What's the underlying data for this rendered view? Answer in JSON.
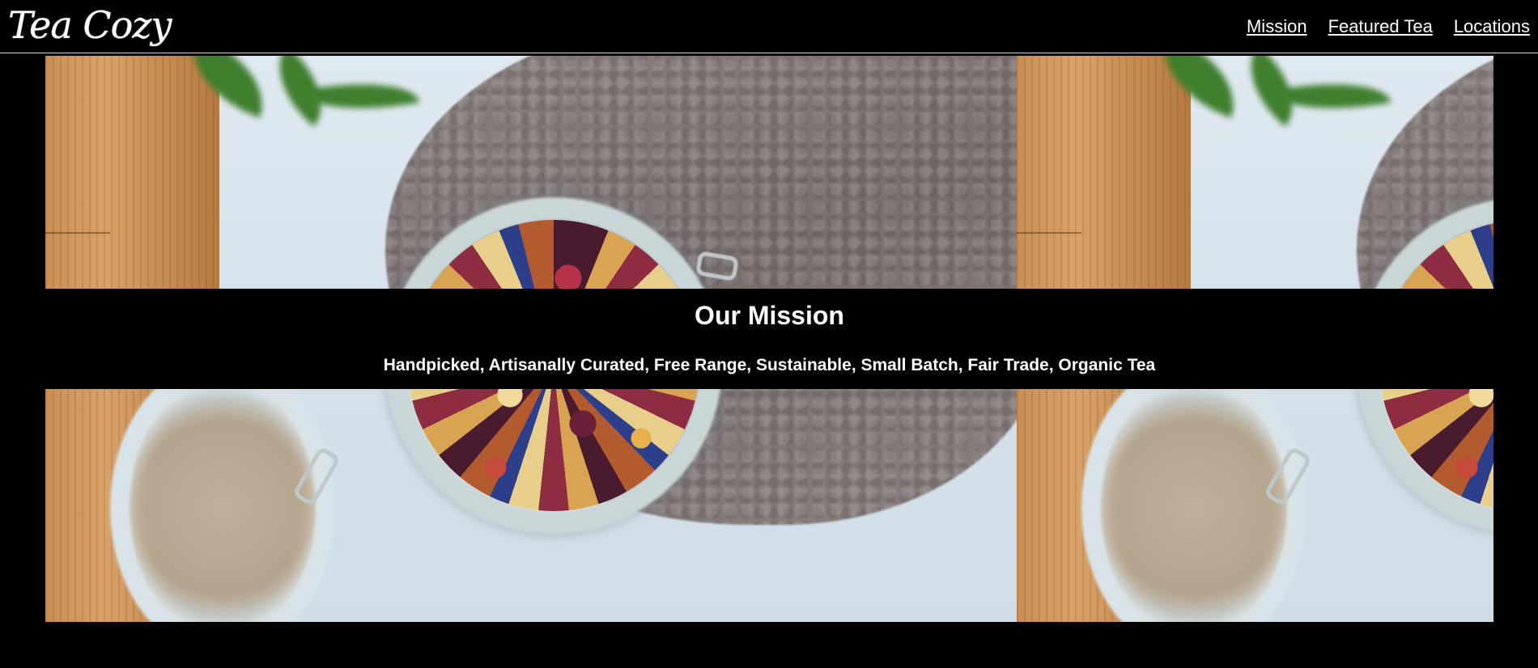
{
  "header": {
    "logo_text": "Tea Cozy",
    "nav": [
      "Mission",
      "Featured Tea",
      "Locations"
    ]
  },
  "hero": {
    "image_description_icon": "tea-jar-photo",
    "mission_title": "Our Mission",
    "mission_text": "Handpicked, Artisanally Curated, Free Range, Sustainable, Small Batch, Fair Trade, Organic Tea"
  },
  "colors": {
    "background": "#000000",
    "text": "#ffffff",
    "header_border": "#d8d8d8"
  }
}
